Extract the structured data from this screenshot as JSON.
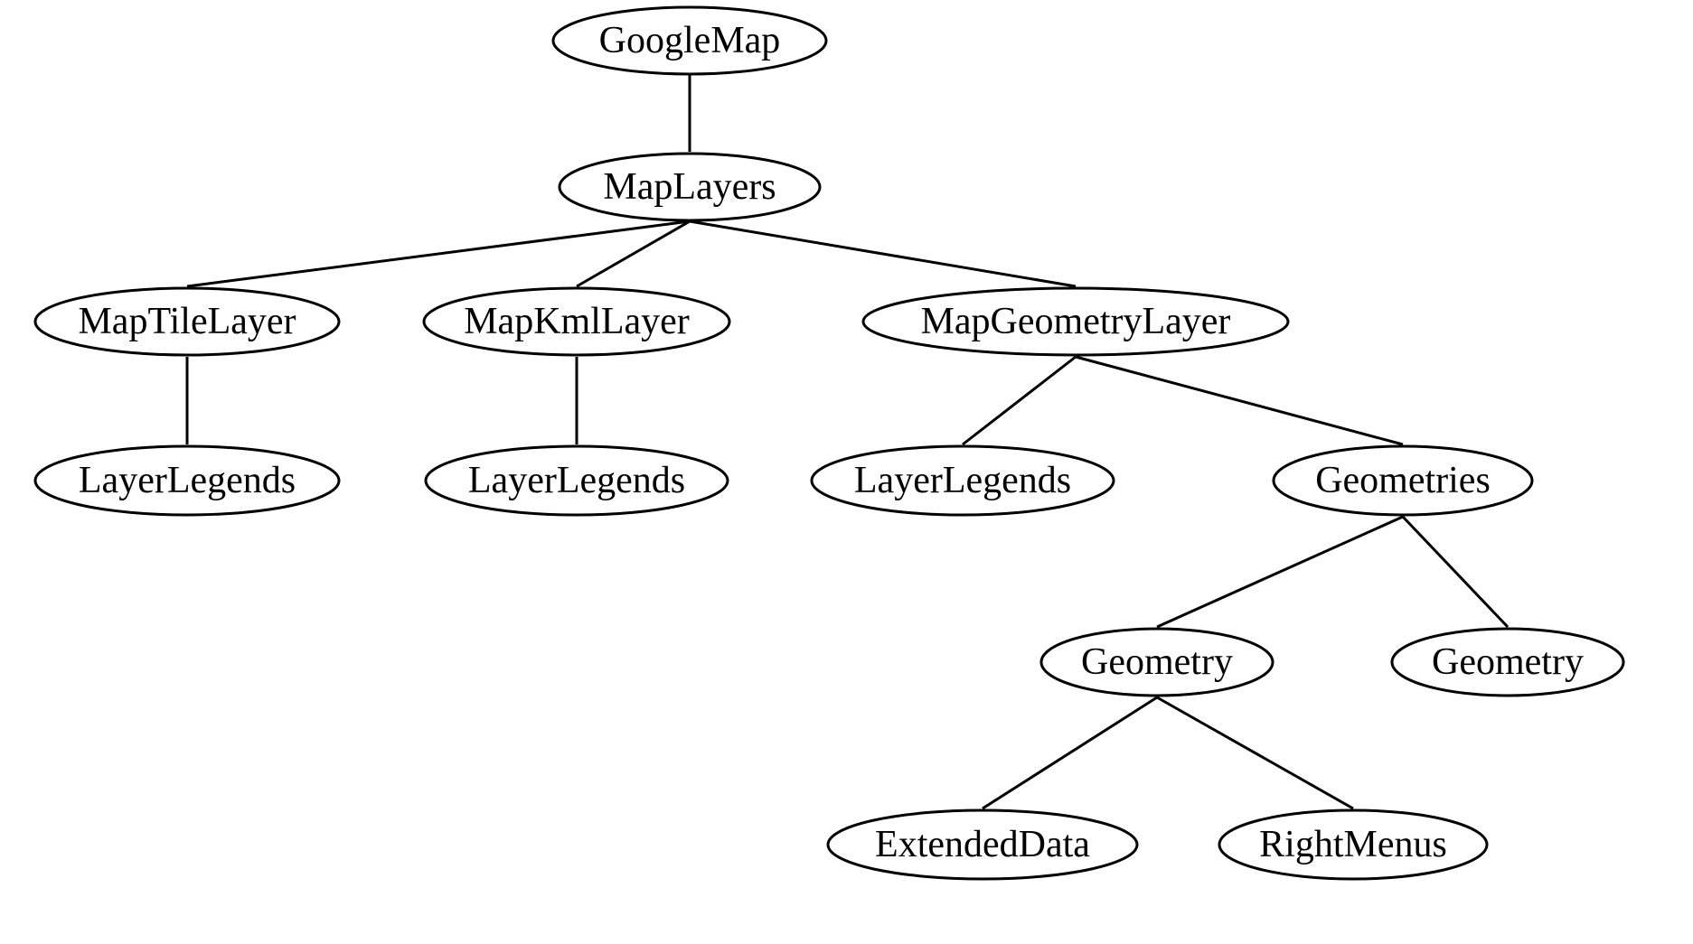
{
  "chart_data": {
    "type": "tree",
    "title": "",
    "nodes": [
      {
        "id": "googlemap",
        "label": "GoogleMap"
      },
      {
        "id": "maplayers",
        "label": "MapLayers"
      },
      {
        "id": "maptilelayer",
        "label": "MapTileLayer"
      },
      {
        "id": "mapkmllayer",
        "label": "MapKmlLayer"
      },
      {
        "id": "mapgeometrylayer",
        "label": "MapGeometryLayer"
      },
      {
        "id": "layerlegends1",
        "label": "LayerLegends"
      },
      {
        "id": "layerlegends2",
        "label": "LayerLegends"
      },
      {
        "id": "layerlegends3",
        "label": "LayerLegends"
      },
      {
        "id": "geometries",
        "label": "Geometries"
      },
      {
        "id": "geometry1",
        "label": "Geometry"
      },
      {
        "id": "geometry2",
        "label": "Geometry"
      },
      {
        "id": "extendeddata",
        "label": "ExtendedData"
      },
      {
        "id": "rightmenus",
        "label": "RightMenus"
      }
    ],
    "edges": [
      {
        "from": "googlemap",
        "to": "maplayers"
      },
      {
        "from": "maplayers",
        "to": "maptilelayer"
      },
      {
        "from": "maplayers",
        "to": "mapkmllayer"
      },
      {
        "from": "maplayers",
        "to": "mapgeometrylayer"
      },
      {
        "from": "maptilelayer",
        "to": "layerlegends1"
      },
      {
        "from": "mapkmllayer",
        "to": "layerlegends2"
      },
      {
        "from": "mapgeometrylayer",
        "to": "layerlegends3"
      },
      {
        "from": "mapgeometrylayer",
        "to": "geometries"
      },
      {
        "from": "geometries",
        "to": "geometry1"
      },
      {
        "from": "geometries",
        "to": "geometry2"
      },
      {
        "from": "geometry1",
        "to": "extendeddata"
      },
      {
        "from": "geometry1",
        "to": "rightmenus"
      }
    ]
  },
  "nodes": {
    "googlemap": {
      "label": "GoogleMap"
    },
    "maplayers": {
      "label": "MapLayers"
    },
    "maptilelayer": {
      "label": "MapTileLayer"
    },
    "mapkmllayer": {
      "label": "MapKmlLayer"
    },
    "mapgeometrylayer": {
      "label": "MapGeometryLayer"
    },
    "layerlegends1": {
      "label": "LayerLegends"
    },
    "layerlegends2": {
      "label": "LayerLegends"
    },
    "layerlegends3": {
      "label": "LayerLegends"
    },
    "geometries": {
      "label": "Geometries"
    },
    "geometry1": {
      "label": "Geometry"
    },
    "geometry2": {
      "label": "Geometry"
    },
    "extendeddata": {
      "label": "ExtendedData"
    },
    "rightmenus": {
      "label": "RightMenus"
    }
  }
}
